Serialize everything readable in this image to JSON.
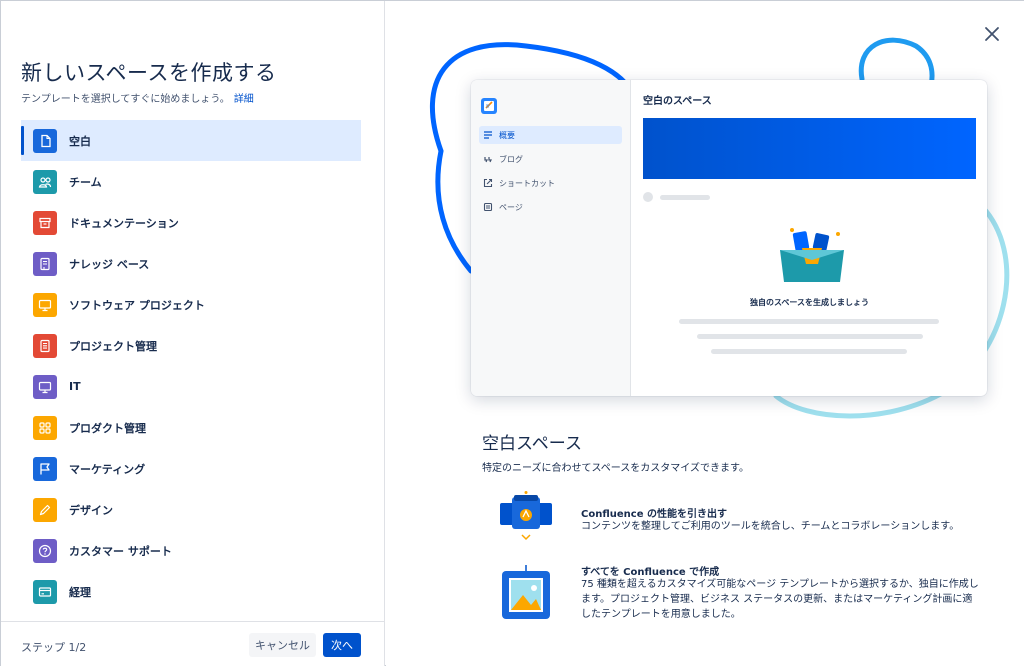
{
  "dialog": {
    "title": "新しいスペースを作成する",
    "subtitle": "テンプレートを選択してすぐに始めましょう。",
    "details_link": "詳細"
  },
  "templates": [
    {
      "label": "空白",
      "color": "#1868db",
      "icon": "page-icon",
      "selected": true
    },
    {
      "label": "チーム",
      "color": "#1d9aaa",
      "icon": "people-icon"
    },
    {
      "label": "ドキュメンテーション",
      "color": "#e34935",
      "icon": "archive-icon"
    },
    {
      "label": "ナレッジ ベース",
      "color": "#6e5dc6",
      "icon": "book-icon"
    },
    {
      "label": "ソフトウェア プロジェクト",
      "color": "#fca700",
      "icon": "monitor-icon"
    },
    {
      "label": "プロジェクト管理",
      "color": "#e34935",
      "icon": "document-icon"
    },
    {
      "label": "IT",
      "color": "#6e5dc6",
      "icon": "monitor-icon"
    },
    {
      "label": "プロダクト管理",
      "color": "#fca700",
      "icon": "grid-icon"
    },
    {
      "label": "マーケティング",
      "color": "#1868db",
      "icon": "flag-icon"
    },
    {
      "label": "デザイン",
      "color": "#fca700",
      "icon": "pencil-icon"
    },
    {
      "label": "カスタマー サポート",
      "color": "#6e5dc6",
      "icon": "question-icon"
    },
    {
      "label": "経理",
      "color": "#1d9aaa",
      "icon": "card-icon"
    }
  ],
  "footer": {
    "step": "ステップ 1/2",
    "cancel": "キャンセル",
    "next": "次へ"
  },
  "preview": {
    "nav": [
      {
        "label": "概要",
        "icon": "list-icon",
        "active": true
      },
      {
        "label": "ブログ",
        "icon": "quote-icon"
      },
      {
        "label": "ショートカット",
        "icon": "external-link-icon"
      },
      {
        "label": "ページ",
        "icon": "page-icon"
      }
    ],
    "space_title": "空白のスペース",
    "caption": "独自のスペースを生成しましょう"
  },
  "detail": {
    "title": "空白スペース",
    "description": "特定のニーズに合わせてスペースをカスタマイズできます。",
    "features": [
      {
        "title": "Confluence の性能を引き出す",
        "text": "コンテンツを整理してご利用のツールを統合し、チームとコラボレーションします。"
      },
      {
        "title": "すべてを Confluence で作成",
        "text": "75 種類を超えるカスタマイズ可能なページ テンプレートから選択するか、独自に作成します。プロジェクト管理、ビジネス ステータスの更新、またはマーケティング計画に適したテンプレートを用意しました。"
      }
    ]
  },
  "colors": {
    "accent": "#0052cc",
    "selected_bg": "#deebff"
  }
}
